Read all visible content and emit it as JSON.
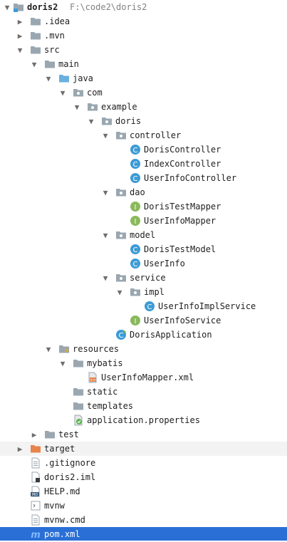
{
  "colors": {
    "folder": "#9aa7b0",
    "source_folder": "#6ab0de",
    "excluded_folder": "#e8834b",
    "class_icon": "#3d9bd6",
    "interface_icon": "#8ab95b",
    "selection": "#2a6fd6",
    "target_row": "#f3f3f3"
  },
  "rows": [
    {
      "id": "root",
      "label": "doris2",
      "hint": "F:\\code2\\doris2",
      "icon": "module-folder-icon",
      "expanded": true
    },
    {
      "id": "idea",
      "label": ".idea",
      "icon": "folder-icon",
      "expanded": false
    },
    {
      "id": "mvn",
      "label": ".mvn",
      "icon": "folder-icon",
      "expanded": false
    },
    {
      "id": "src",
      "label": "src",
      "icon": "folder-icon",
      "expanded": true
    },
    {
      "id": "main",
      "label": "main",
      "icon": "folder-icon",
      "expanded": true
    },
    {
      "id": "java",
      "label": "java",
      "icon": "source-folder-icon",
      "expanded": true
    },
    {
      "id": "com",
      "label": "com",
      "icon": "package-icon",
      "expanded": true
    },
    {
      "id": "example",
      "label": "example",
      "icon": "package-icon",
      "expanded": true
    },
    {
      "id": "doris",
      "label": "doris",
      "icon": "package-icon",
      "expanded": true
    },
    {
      "id": "controller",
      "label": "controller",
      "icon": "package-icon",
      "expanded": true
    },
    {
      "id": "DorisController",
      "label": "DorisController",
      "icon": "class-icon"
    },
    {
      "id": "IndexController",
      "label": "IndexController",
      "icon": "class-icon"
    },
    {
      "id": "UserInfoController",
      "label": "UserInfoController",
      "icon": "class-icon"
    },
    {
      "id": "dao",
      "label": "dao",
      "icon": "package-icon",
      "expanded": true
    },
    {
      "id": "DorisTestMapper",
      "label": "DorisTestMapper",
      "icon": "interface-icon"
    },
    {
      "id": "UserInfoMapper",
      "label": "UserInfoMapper",
      "icon": "interface-icon"
    },
    {
      "id": "model",
      "label": "model",
      "icon": "package-icon",
      "expanded": true
    },
    {
      "id": "DorisTestModel",
      "label": "DorisTestModel",
      "icon": "class-icon"
    },
    {
      "id": "UserInfo",
      "label": "UserInfo",
      "icon": "class-icon"
    },
    {
      "id": "service",
      "label": "service",
      "icon": "package-icon",
      "expanded": true
    },
    {
      "id": "impl",
      "label": "impl",
      "icon": "package-icon",
      "expanded": true
    },
    {
      "id": "UserInfoImplService",
      "label": "UserInfoImplService",
      "icon": "class-icon"
    },
    {
      "id": "UserInfoService",
      "label": "UserInfoService",
      "icon": "interface-icon"
    },
    {
      "id": "DorisApplication",
      "label": "DorisApplication",
      "icon": "spring-class-icon"
    },
    {
      "id": "resources",
      "label": "resources",
      "icon": "resources-folder-icon",
      "expanded": true
    },
    {
      "id": "mybatis",
      "label": "mybatis",
      "icon": "folder-icon",
      "expanded": true
    },
    {
      "id": "UserInfoMapperXml",
      "label": "UserInfoMapper.xml",
      "icon": "xml-file-icon"
    },
    {
      "id": "static",
      "label": "static",
      "icon": "folder-icon"
    },
    {
      "id": "templates",
      "label": "templates",
      "icon": "folder-icon"
    },
    {
      "id": "appprops",
      "label": "application.properties",
      "icon": "properties-file-icon"
    },
    {
      "id": "test",
      "label": "test",
      "icon": "folder-icon",
      "expanded": false
    },
    {
      "id": "target",
      "label": "target",
      "icon": "excluded-folder-icon",
      "expanded": false
    },
    {
      "id": "gitignore",
      "label": ".gitignore",
      "icon": "text-file-icon"
    },
    {
      "id": "iml",
      "label": "doris2.iml",
      "icon": "iml-file-icon"
    },
    {
      "id": "help",
      "label": "HELP.md",
      "icon": "markdown-file-icon"
    },
    {
      "id": "mvnw",
      "label": "mvnw",
      "icon": "script-file-icon"
    },
    {
      "id": "mvnwcmd",
      "label": "mvnw.cmd",
      "icon": "text-file-icon"
    },
    {
      "id": "pom",
      "label": "pom.xml",
      "icon": "maven-file-icon",
      "selected": true
    }
  ]
}
